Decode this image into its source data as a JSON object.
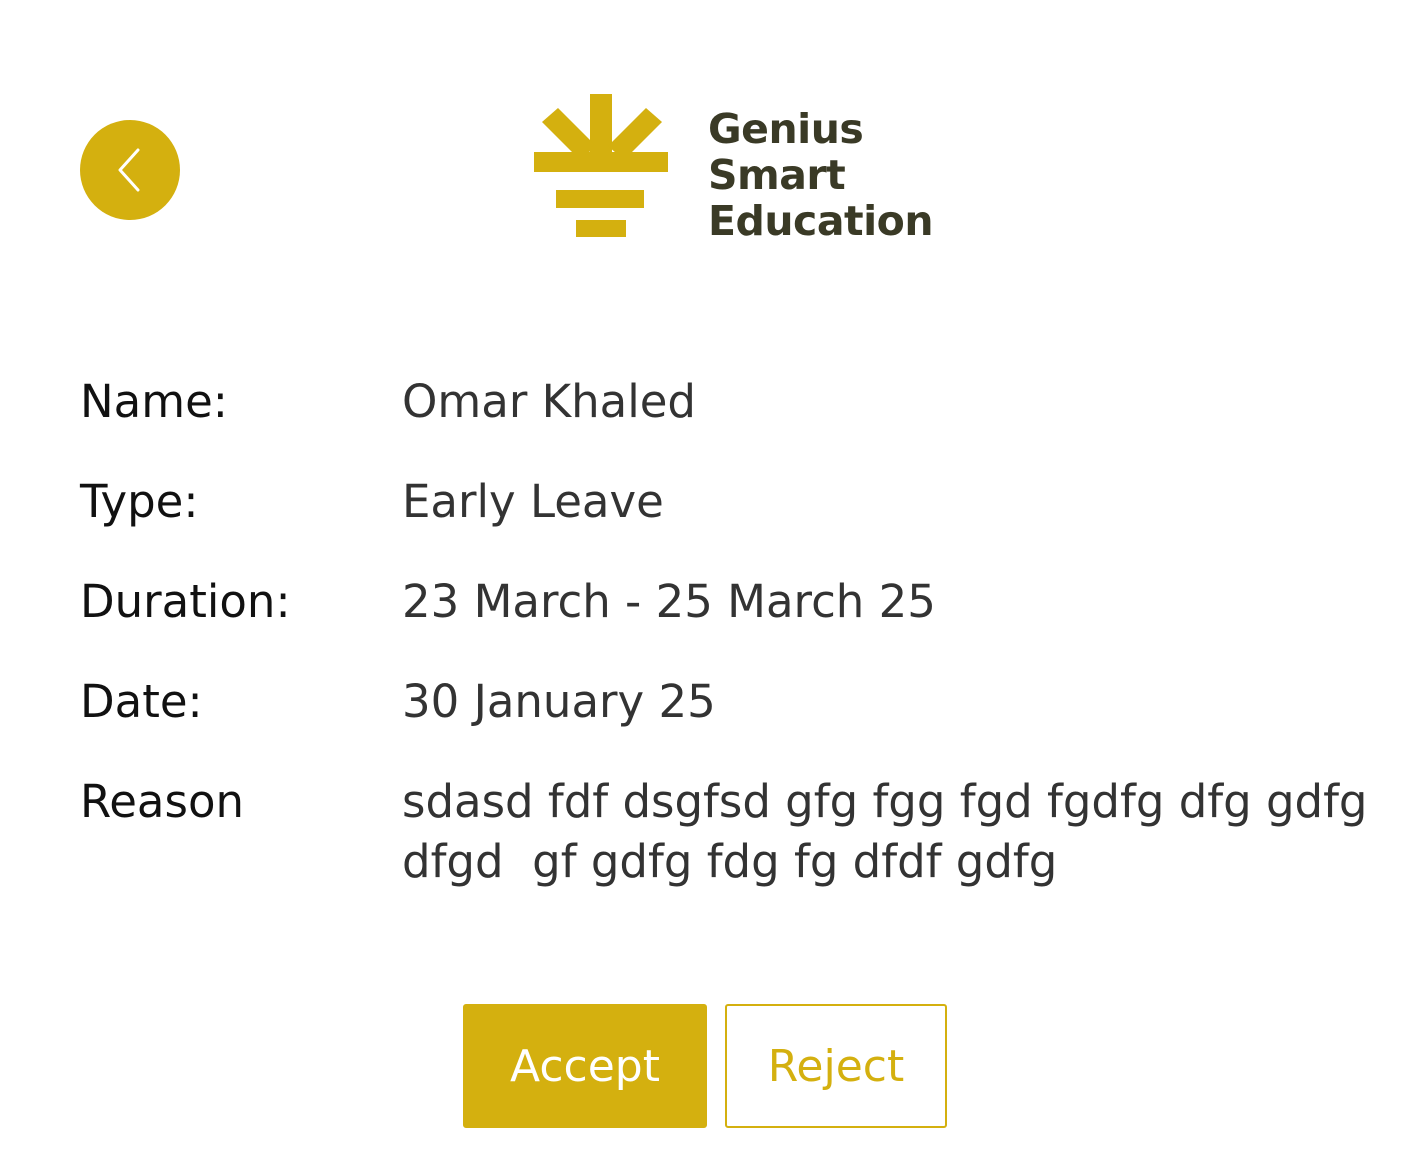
{
  "header": {
    "back_icon": "chevron-left-icon",
    "logo": {
      "line1": "Genius",
      "line2": "Smart",
      "line3": "Education"
    }
  },
  "details": {
    "name": {
      "label": "Name:",
      "value": "Omar Khaled"
    },
    "type": {
      "label": "Type:",
      "value": "Early Leave"
    },
    "duration": {
      "label": "Duration:",
      "value": "23 March - 25 March 25"
    },
    "date": {
      "label": "Date:",
      "value": "30 January 25"
    },
    "reason": {
      "label": "Reason",
      "value": "sdasd fdf dsgfsd gfg fgg fgd fgdfg dfg gdfg dfgd  gf gdfg fdg fg dfdf gdfg"
    }
  },
  "actions": {
    "accept_label": "Accept",
    "reject_label": "Reject"
  },
  "colors": {
    "accent": "#d4b00f",
    "logo_text": "#3a3a26",
    "label_text": "#111111",
    "value_text": "#333333"
  }
}
